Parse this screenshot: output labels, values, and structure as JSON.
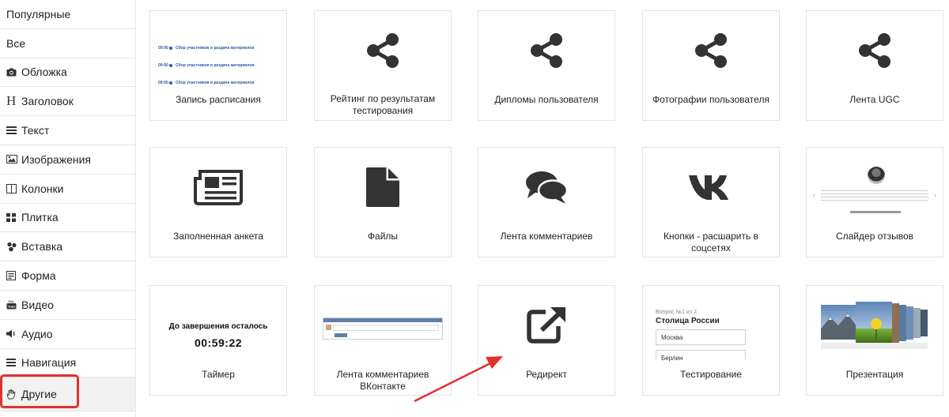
{
  "sidebar": {
    "items": [
      {
        "label": "Популярные",
        "icon": ""
      },
      {
        "label": "Все",
        "icon": ""
      },
      {
        "label": "Обложка",
        "icon": "camera-icon"
      },
      {
        "label": "Заголовок",
        "icon": "heading-icon"
      },
      {
        "label": "Текст",
        "icon": "text-lines-icon"
      },
      {
        "label": "Изображения",
        "icon": "image-icon"
      },
      {
        "label": "Колонки",
        "icon": "columns-icon"
      },
      {
        "label": "Плитка",
        "icon": "tiles-icon"
      },
      {
        "label": "Вставка",
        "icon": "puzzle-icon"
      },
      {
        "label": "Форма",
        "icon": "form-icon"
      },
      {
        "label": "Видео",
        "icon": "youtube-icon"
      },
      {
        "label": "Аудио",
        "icon": "speaker-icon"
      },
      {
        "label": "Навигация",
        "icon": "menu-icon"
      },
      {
        "label": "Другие",
        "icon": "hand-icon"
      }
    ],
    "heading_glyph": "H",
    "active": "Другие",
    "highlight_color": "#e0322c"
  },
  "cards": [
    {
      "label": "Запись расписания",
      "art": "schedule-preview"
    },
    {
      "label": "Рейтинг по результатам тестирования",
      "art": "share-icon"
    },
    {
      "label": "Дипломы пользователя",
      "art": "share-icon"
    },
    {
      "label": "Фотографии пользователя",
      "art": "share-icon"
    },
    {
      "label": "Лента UGC",
      "art": "share-icon"
    },
    {
      "label": "Заполненная анкета",
      "art": "newspaper-icon"
    },
    {
      "label": "Файлы",
      "art": "file-icon"
    },
    {
      "label": "Лента комментариев",
      "art": "comments-icon"
    },
    {
      "label": "Кнопки - расшарить в соцсетях",
      "art": "vk-icon"
    },
    {
      "label": "Слайдер отзывов",
      "art": "reviews-preview"
    },
    {
      "label": "Таймер",
      "art": "timer-preview"
    },
    {
      "label": "Лента комментариев ВКонтакте",
      "art": "vk-comments-preview"
    },
    {
      "label": "Редирект",
      "art": "external-link-icon"
    },
    {
      "label": "Тестирование",
      "art": "test-preview"
    },
    {
      "label": "Презентация",
      "art": "presentation-preview"
    }
  ],
  "schedule_preview": {
    "rows": [
      {
        "time": "09:00",
        "text": "Сбор участников и раздача материалов"
      },
      {
        "time": "09:00",
        "text": "Сбор участников и раздача материалов"
      },
      {
        "time": "09:00",
        "text": "Сбор участников и раздача материалов"
      }
    ]
  },
  "timer_preview": {
    "title": "До завершения осталось",
    "time": "00:59:22"
  },
  "test_preview": {
    "question": "Вопрос №1 из 2",
    "title": "Столица России",
    "options": [
      "Москва",
      "Берлин"
    ]
  },
  "colors": {
    "accent_blue": "#2b5aa8",
    "icon_dark": "#333333",
    "annotation_red": "#e0322c"
  },
  "annotation": {
    "arrow": "red-arrow-pointing-to-redirect"
  }
}
